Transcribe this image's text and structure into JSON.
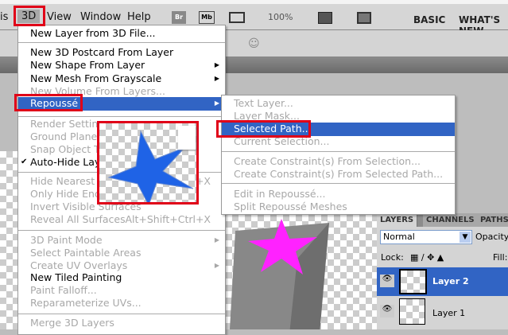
{
  "menubar": {
    "items": [
      "is",
      "3D",
      "View",
      "Window",
      "Help"
    ],
    "zoom": "100%",
    "workspaces": [
      "BASIC",
      "WHAT'S NEW"
    ],
    "bridge": "Br",
    "minibridge": "Mb"
  },
  "menu3d": {
    "items": [
      {
        "label": "New Layer from 3D File..."
      },
      {
        "label": "New 3D Postcard From Layer"
      },
      {
        "label": "New Shape From Layer"
      },
      {
        "label": "New Mesh From Grayscale"
      },
      {
        "label": "New Volume From Layers..."
      },
      {
        "label": "Repoussé"
      },
      {
        "label": "Render Settings..."
      },
      {
        "label": "Ground Plane S"
      },
      {
        "label": "Snap Object To"
      },
      {
        "label": "Auto-Hide Laye"
      },
      {
        "label": "Hide Nearest S",
        "shortcut": "+X"
      },
      {
        "label": "Only Hide Encl"
      },
      {
        "label": "Invert Visible Surfaces"
      },
      {
        "label": "Reveal All Surfaces",
        "shortcut": "Alt+Shift+Ctrl+X"
      },
      {
        "label": "3D Paint Mode"
      },
      {
        "label": "Select Paintable Areas"
      },
      {
        "label": "Create UV Overlays"
      },
      {
        "label": "New Tiled Painting"
      },
      {
        "label": "Paint Falloff..."
      },
      {
        "label": "Reparameterize UVs..."
      },
      {
        "label": "Merge 3D Layers"
      }
    ]
  },
  "submenu": {
    "items": [
      "Text Layer...",
      "Layer Mask...",
      "Selected Path...",
      "Current Selection...",
      "Create Constraint(s) From Selection...",
      "Create Constraint(s) From Selected Path...",
      "Edit in Repoussé...",
      "Split Repoussé Meshes"
    ]
  },
  "layers": {
    "tabs": [
      "LAYERS",
      "CHANNELS",
      "PATHS"
    ],
    "blend": "Normal",
    "opacity_label": "Opacity:",
    "lock_label": "Lock:",
    "fill_label": "Fill:",
    "rows": [
      "Layer 2",
      "Layer 1"
    ]
  },
  "colors": {
    "accent": "#3164c4",
    "highlight": "#e00018",
    "star_blue": "#1f63e6",
    "star_magenta": "#ff22ff"
  }
}
